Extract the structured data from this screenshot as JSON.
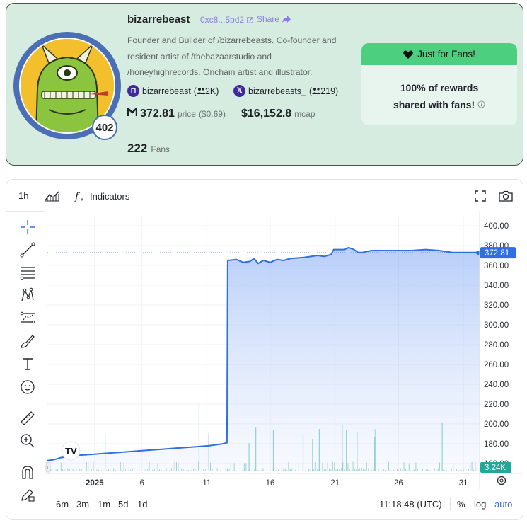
{
  "profile": {
    "name": "bizarrebeast",
    "address": "0xc8...5bd2",
    "share_label": "Share",
    "level": "402",
    "bio_lines": [
      "Founder and Builder of /bizarrebeasts. Co-founder and",
      "resident artist of /thebazaarstudio and",
      "/honeyhighrecords. Onchain artist and illustrator."
    ],
    "farcaster": {
      "handle": "bizarrebeast",
      "followers": "2K"
    },
    "x": {
      "handle": "bizarrebeasts_",
      "followers": "219"
    },
    "price_value": "372.81",
    "price_label": "price",
    "price_usd": "($0.69)",
    "mcap_value": "$16,152.8",
    "mcap_label": "mcap",
    "fans_count": "222",
    "fans_label": "Fans"
  },
  "promo": {
    "title": "Just for Fans!",
    "line1": "100% of rewards",
    "line2": "shared with fans!"
  },
  "toolbar": {
    "interval": "1h",
    "indicators_label": "Indicators"
  },
  "chart_data": {
    "type": "area",
    "y_ticks": [
      "400.00",
      "380.00",
      "360.00",
      "340.00",
      "320.00",
      "300.00",
      "280.00",
      "260.00",
      "240.00",
      "220.00",
      "200.00",
      "180.00",
      "160.00"
    ],
    "x_ticks": [
      "2025",
      "6",
      "11",
      "16",
      "21",
      "26",
      "31"
    ],
    "ylim": [
      150,
      405
    ],
    "current_price_label": "372.81",
    "current_price": 372.81,
    "volume_label": "3.24K",
    "series": [
      {
        "x": [
          0,
          0.5,
          1,
          1.5,
          2,
          3,
          4,
          5,
          6,
          7,
          8,
          9,
          10,
          11,
          12,
          13,
          13.3,
          13.35,
          14,
          14.5,
          15,
          15.3,
          15.6,
          16,
          16.5,
          17,
          17.5,
          18,
          19,
          20,
          20.5,
          21,
          21.2,
          22,
          22.3,
          22.7,
          23,
          23.3,
          24,
          25,
          26,
          27,
          28,
          29,
          30,
          30.3,
          31,
          32
        ],
        "y": [
          163,
          164,
          166,
          167,
          168,
          169,
          170,
          171,
          172,
          173,
          174,
          175,
          176,
          177,
          178,
          180,
          181,
          365,
          366,
          363,
          364,
          367,
          362,
          365,
          363,
          366,
          365,
          367,
          368,
          370,
          369,
          371,
          376,
          376,
          378,
          376,
          373,
          373,
          375,
          375,
          375,
          375,
          376,
          375,
          373,
          373,
          373,
          373
        ]
      }
    ]
  },
  "timeframes": [
    "6m",
    "3m",
    "1m",
    "5d",
    "1d"
  ],
  "footer": {
    "clock": "11:18:48 (UTC)",
    "percent_label": "%",
    "log_label": "log",
    "auto_label": "auto"
  },
  "colors": {
    "accent": "#4cd07f",
    "purple": "#8b7be6",
    "line": "#2f6ee5",
    "price_badge": "#2f6ee5",
    "volume": "#26a69a"
  }
}
